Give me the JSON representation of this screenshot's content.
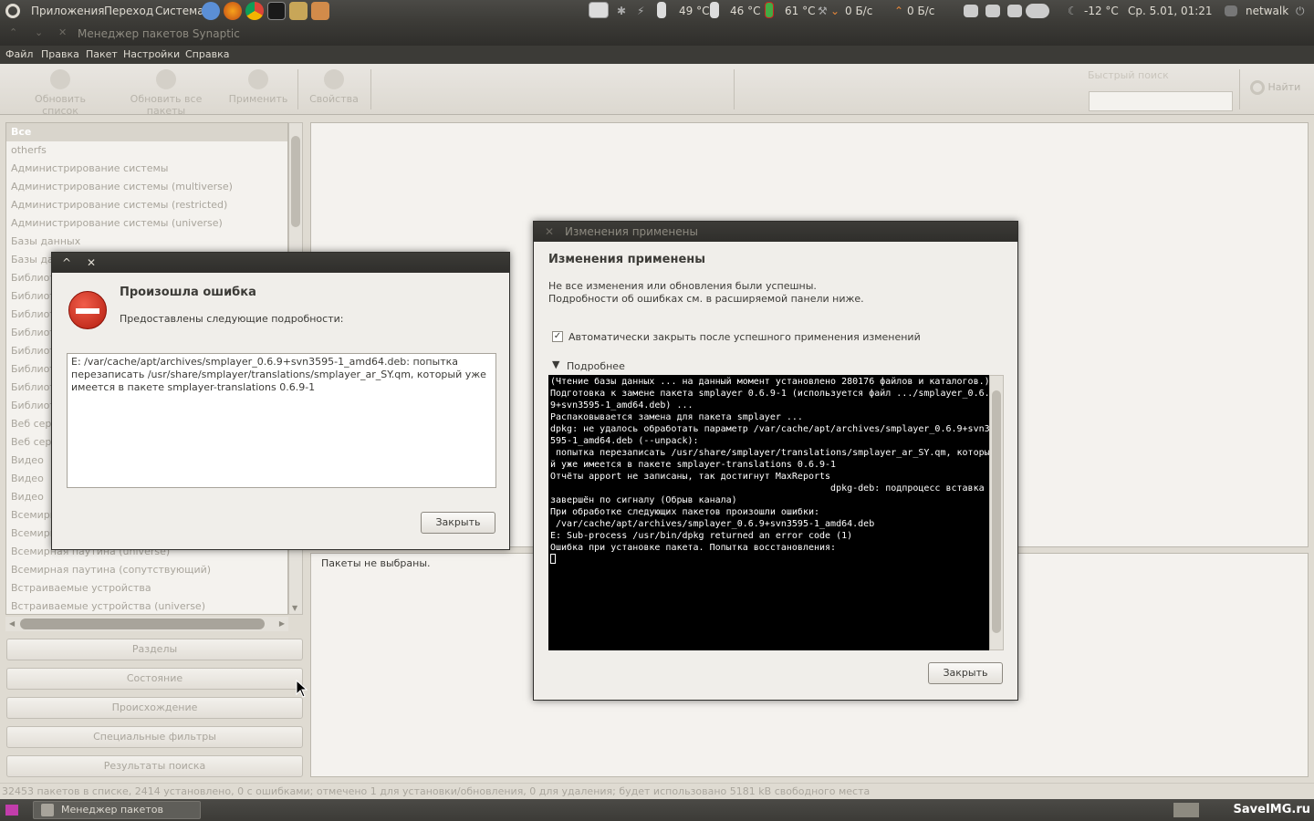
{
  "top_panel": {
    "menu": [
      "Приложения",
      "Переход",
      "Система"
    ],
    "temp1": "49 °C",
    "temp2": "46 °C",
    "temp3": "61 °C",
    "net_down": "0 Б/с",
    "net_up": "0 Б/с",
    "weather": "-12 °C",
    "datetime": "Ср.  5.01, 01:21",
    "user": "netwalk"
  },
  "window": {
    "title": "Менеджер пакетов Synaptic"
  },
  "menubar": [
    "Файл",
    "Правка",
    "Пакет",
    "Настройки",
    "Справка"
  ],
  "toolbar": {
    "reload": "Обновить список",
    "upgrade_all": "Обновить все пакеты",
    "apply": "Применить",
    "properties": "Свойства",
    "quick_search_label": "Быстрый поиск",
    "search": "Найти"
  },
  "sections": [
    "Все",
    "otherfs",
    "Администрирование системы",
    "Администрирование системы (multiverse)",
    "Администрирование системы (restricted)",
    "Администрирование системы (universe)",
    "Базы данных",
    "Базы данных (universe)",
    "Библиотеки",
    "Библиотеки",
    "Библиотеки",
    "Библиотеки",
    "Библиотеки",
    "Библиотеки",
    "Библиотеки",
    "Библиотеки",
    "Веб сервер",
    "Веб сервер",
    "Видео",
    "Видео",
    "Видео",
    "Всемирная паутина",
    "Всемирная паутина",
    "Всемирная паутина (universe)",
    "Всемирная паутина (сопутствующий)",
    "Встраиваемые устройства",
    "Встраиваемые устройства (universe)"
  ],
  "filter_buttons": [
    "Разделы",
    "Состояние",
    "Происхождение",
    "Специальные фильтры",
    "Результаты поиска"
  ],
  "description": "Пакеты не выбраны.",
  "statusbar": "32453 пакетов в списке, 2414 установлено, 0 с ошибками; отмечено 1 для установки/обновления, 0 для удаления; будет использовано 5181 kB свободного места",
  "taskbar": {
    "task": "Менеджер пакетов Synap...",
    "watermark": "SaveIMG.ru"
  },
  "error_dialog": {
    "heading": "Произошла ошибка",
    "subheading": "Предоставлены следующие подробности:",
    "details": "E: /var/cache/apt/archives/smplayer_0.6.9+svn3595-1_amd64.deb: попытка перезаписать /usr/share/smplayer/translations/smplayer_ar_SY.qm, который уже имеется в пакете smplayer-translations 0.6.9-1",
    "close": "Закрыть"
  },
  "changes_dialog": {
    "title": "Изменения применены",
    "heading": "Изменения применены",
    "message": "Не все изменения или обновления были успешны.\nПодробности об ошибках см. в расширяемой панели ниже.",
    "auto_close": "Автоматически закрыть после успешного применения изменений",
    "details_label": "Подробнее",
    "terminal": "(Чтение базы данных ... на данный момент установлено 280176 файлов и каталогов.)\nПодготовка к замене пакета smplayer 0.6.9-1 (используется файл .../smplayer_0.6.\n9+svn3595-1_amd64.deb) ...\nРаспаковывается замена для пакета smplayer ...\ndpkg: не удалось обработать параметр /var/cache/apt/archives/smplayer_0.6.9+svn3\n595-1_amd64.deb (--unpack):\n попытка перезаписать /usr/share/smplayer/translations/smplayer_ar_SY.qm, которы\nй уже имеется в пакете smplayer-translations 0.6.9-1\nОтчёты apport не записаны, так достигнут MaxReports\n                                                   dpkg-deb: подпроцесс вставка\nзавершён по сигналу (Обрыв канала)\nПри обработке следующих пакетов произошли ошибки:\n /var/cache/apt/archives/smplayer_0.6.9+svn3595-1_amd64.deb\nE: Sub-process /usr/bin/dpkg returned an error code (1)\nОшибка при установке пакета. Попытка восстановления:",
    "close": "Закрыть"
  }
}
